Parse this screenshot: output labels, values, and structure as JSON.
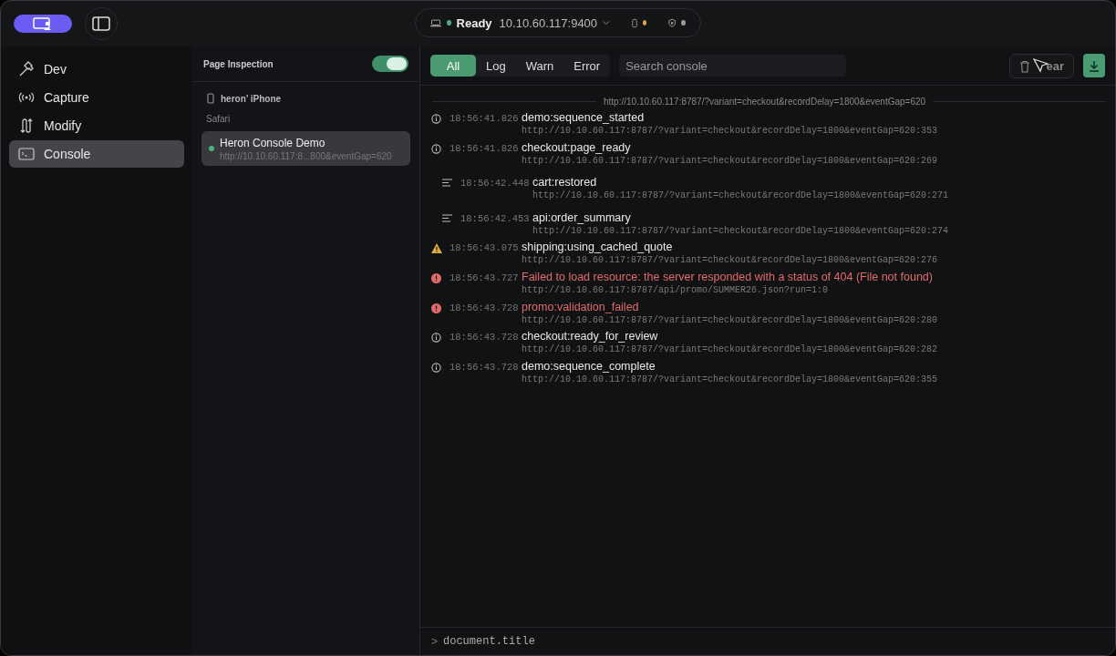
{
  "topbar": {
    "status": {
      "label": "Ready",
      "address": "10.10.60.117:9400"
    }
  },
  "sidebar": {
    "items": [
      {
        "kind": "hammer",
        "label": "Dev",
        "selected": false
      },
      {
        "kind": "signal",
        "label": "Capture",
        "selected": false
      },
      {
        "kind": "arrows",
        "label": "Modify",
        "selected": false
      },
      {
        "kind": "terminal",
        "label": "Console",
        "selected": true
      }
    ]
  },
  "inspection": {
    "title": "Page Inspection",
    "on": true,
    "device": "heron’ iPhone",
    "browser": "Safari",
    "pages": [
      {
        "title": "Heron Console Demo",
        "url": "http://10.10.60.117:8...800&eventGap=620",
        "selected": true
      }
    ]
  },
  "console": {
    "filters": [
      {
        "label": "All",
        "selected": true
      },
      {
        "label": "Log",
        "selected": false
      },
      {
        "label": "Warn",
        "selected": false
      },
      {
        "label": "Error",
        "selected": false
      }
    ],
    "search": {
      "placeholder": "Search console"
    },
    "clear_label": "ear",
    "page_url": "http://10.10.60.117:8787/?variant=checkout&recordDelay=1800&eventGap=620",
    "entries": [
      {
        "kind": "info",
        "time": "18:56:41.826",
        "message": "demo:sequence_started",
        "source": "http://10.10.60.117:8787/?variant=checkout&recordDelay=1800&eventGap=620:353"
      },
      {
        "kind": "info",
        "time": "18:56:41.826",
        "message": "checkout:page_ready",
        "source": "http://10.10.60.117:8787/?variant=checkout&recordDelay=1800&eventGap=620:269"
      },
      {
        "kind": "log",
        "time": "18:56:42.448",
        "message": "cart:restored",
        "source": "http://10.10.60.117:8787/?variant=checkout&recordDelay=1800&eventGap=620:271"
      },
      {
        "kind": "log",
        "time": "18:56:42.453",
        "message": "api:order_summary",
        "source": "http://10.10.60.117:8787/?variant=checkout&recordDelay=1800&eventGap=620:274"
      },
      {
        "kind": "warn",
        "time": "18:56:43.075",
        "message": "shipping:using_cached_quote",
        "source": "http://10.10.60.117:8787/?variant=checkout&recordDelay=1800&eventGap=620:276"
      },
      {
        "kind": "error",
        "time": "18:56:43.727",
        "message": "Failed to load resource: the server responded with a status of 404 (File not found)",
        "source": "http://10.10.60.117:8787/api/promo/SUMMER26.json?run=1:0"
      },
      {
        "kind": "error",
        "time": "18:56:43.728",
        "message": "promo:validation_failed",
        "source": "http://10.10.60.117:8787/?variant=checkout&recordDelay=1800&eventGap=620:280"
      },
      {
        "kind": "info",
        "time": "18:56:43.728",
        "message": "checkout:ready_for_review",
        "source": "http://10.10.60.117:8787/?variant=checkout&recordDelay=1800&eventGap=620:282"
      },
      {
        "kind": "info",
        "time": "18:56:43.728",
        "message": "demo:sequence_complete",
        "source": "http://10.10.60.117:8787/?variant=checkout&recordDelay=1800&eventGap=620:355"
      }
    ],
    "prompt": {
      "symbol": ">",
      "value": "document.title"
    }
  }
}
